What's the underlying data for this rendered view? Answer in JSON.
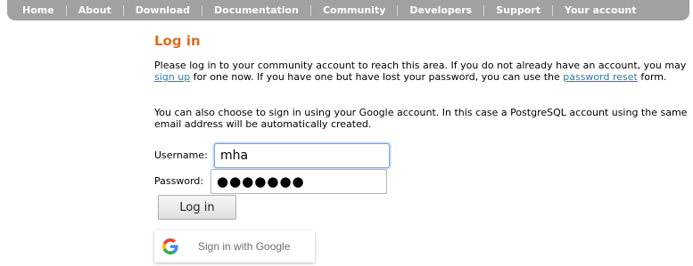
{
  "nav": {
    "items": [
      "Home",
      "About",
      "Download",
      "Documentation",
      "Community",
      "Developers",
      "Support",
      "Your account"
    ]
  },
  "page": {
    "title": "Log in",
    "intro_before": "Please log in to your community account to reach this area. If you do not already have an account, you may ",
    "signup_link": "sign up",
    "intro_middle": " for one now. If you have one but have lost your password, you can use the ",
    "reset_link": "password reset",
    "intro_after": " form.",
    "google_note": "You can also choose to sign in using your Google account. In this case a PostgreSQL account using the same email address will be automatically created."
  },
  "form": {
    "username_label": "Username:",
    "username_value": "mha",
    "password_label": "Password:",
    "password_masked": "●●●●●●●",
    "login_button": "Log in",
    "google_button": "Sign in with Google"
  },
  "colors": {
    "nav_bg": "#a1a1a1",
    "title": "#e26b1b",
    "link": "#2080b0",
    "focus_border": "#7ba3d6"
  },
  "icons": {
    "google": "google-g-icon"
  }
}
